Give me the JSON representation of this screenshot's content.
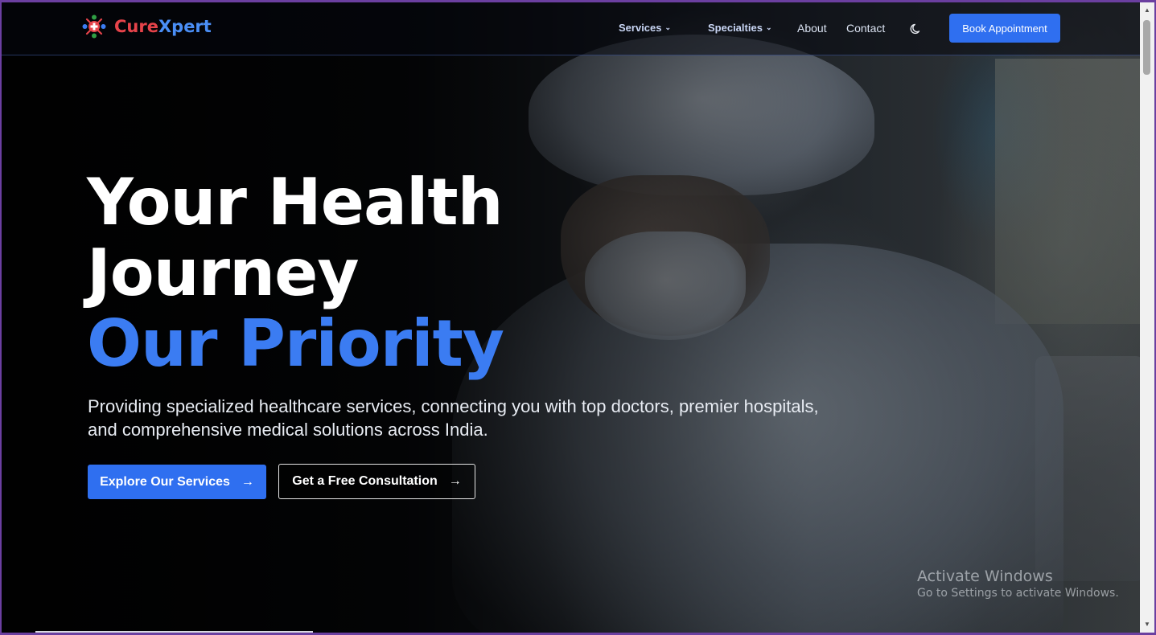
{
  "brand": {
    "name_part1": "Cure",
    "name_part2": "Xpert",
    "icon": "medical-cross-people-icon"
  },
  "nav": {
    "services_label": "Services",
    "specialties_label": "Specialties",
    "about_label": "About",
    "contact_label": "Contact",
    "theme_toggle_icon": "moon-icon",
    "book_label": "Book Appointment"
  },
  "hero": {
    "title_line1": "Your Health",
    "title_line2": "Journey",
    "title_line3": "Our Priority",
    "subtitle_line1": "Providing specialized healthcare services, connecting you with top doctors, premier hospitals,",
    "subtitle_line2": "and comprehensive medical solutions across India.",
    "primary_cta": "Explore Our Services",
    "secondary_cta": "Get a Free Consultation",
    "cta_icon": "arrow-right-icon"
  },
  "watermark": {
    "title": "Activate Windows",
    "subtitle": "Go to Settings to activate Windows."
  },
  "colors": {
    "accent": "#3b7cf2",
    "button": "#2f6ff0",
    "brand_red": "#e6434a",
    "brand_blue": "#4a8ef5"
  }
}
